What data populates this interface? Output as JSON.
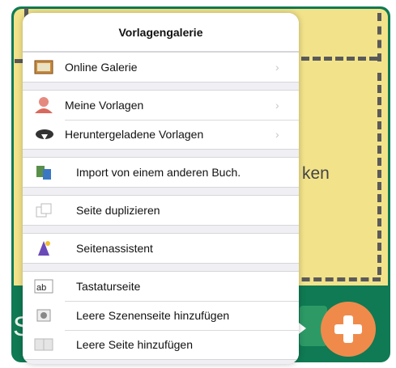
{
  "background": {
    "partial_text": "ken",
    "partial_text_left": "S"
  },
  "popover": {
    "title": "Vorlagengalerie",
    "groups": [
      [
        {
          "label": "Online Galerie",
          "icon": "picture-frame-icon",
          "chevron": true
        }
      ],
      [
        {
          "label": "Meine Vorlagen",
          "icon": "person-icon",
          "chevron": true
        },
        {
          "label": "Heruntergeladene Vorlagen",
          "icon": "cloud-download-icon",
          "chevron": true
        }
      ],
      [
        {
          "label": "Import von einem anderen Buch.",
          "icon": "import-book-icon",
          "chevron": false
        }
      ],
      [
        {
          "label": "Seite duplizieren",
          "icon": "duplicate-pages-icon",
          "chevron": false
        }
      ],
      [
        {
          "label": "Seitenassistent",
          "icon": "wizard-icon",
          "chevron": false
        }
      ],
      [
        {
          "label": "Tastaturseite",
          "icon": "keyboard-page-icon",
          "chevron": false
        },
        {
          "label": "Leere Szenenseite hinzufügen",
          "icon": "scene-page-icon",
          "chevron": false
        },
        {
          "label": "Leere Seite hinzufügen",
          "icon": "blank-page-icon",
          "chevron": false
        }
      ]
    ]
  },
  "colors": {
    "accent_green": "#0f7a53",
    "canvas_yellow": "#f2e38a",
    "add_button": "#f08a4b"
  }
}
